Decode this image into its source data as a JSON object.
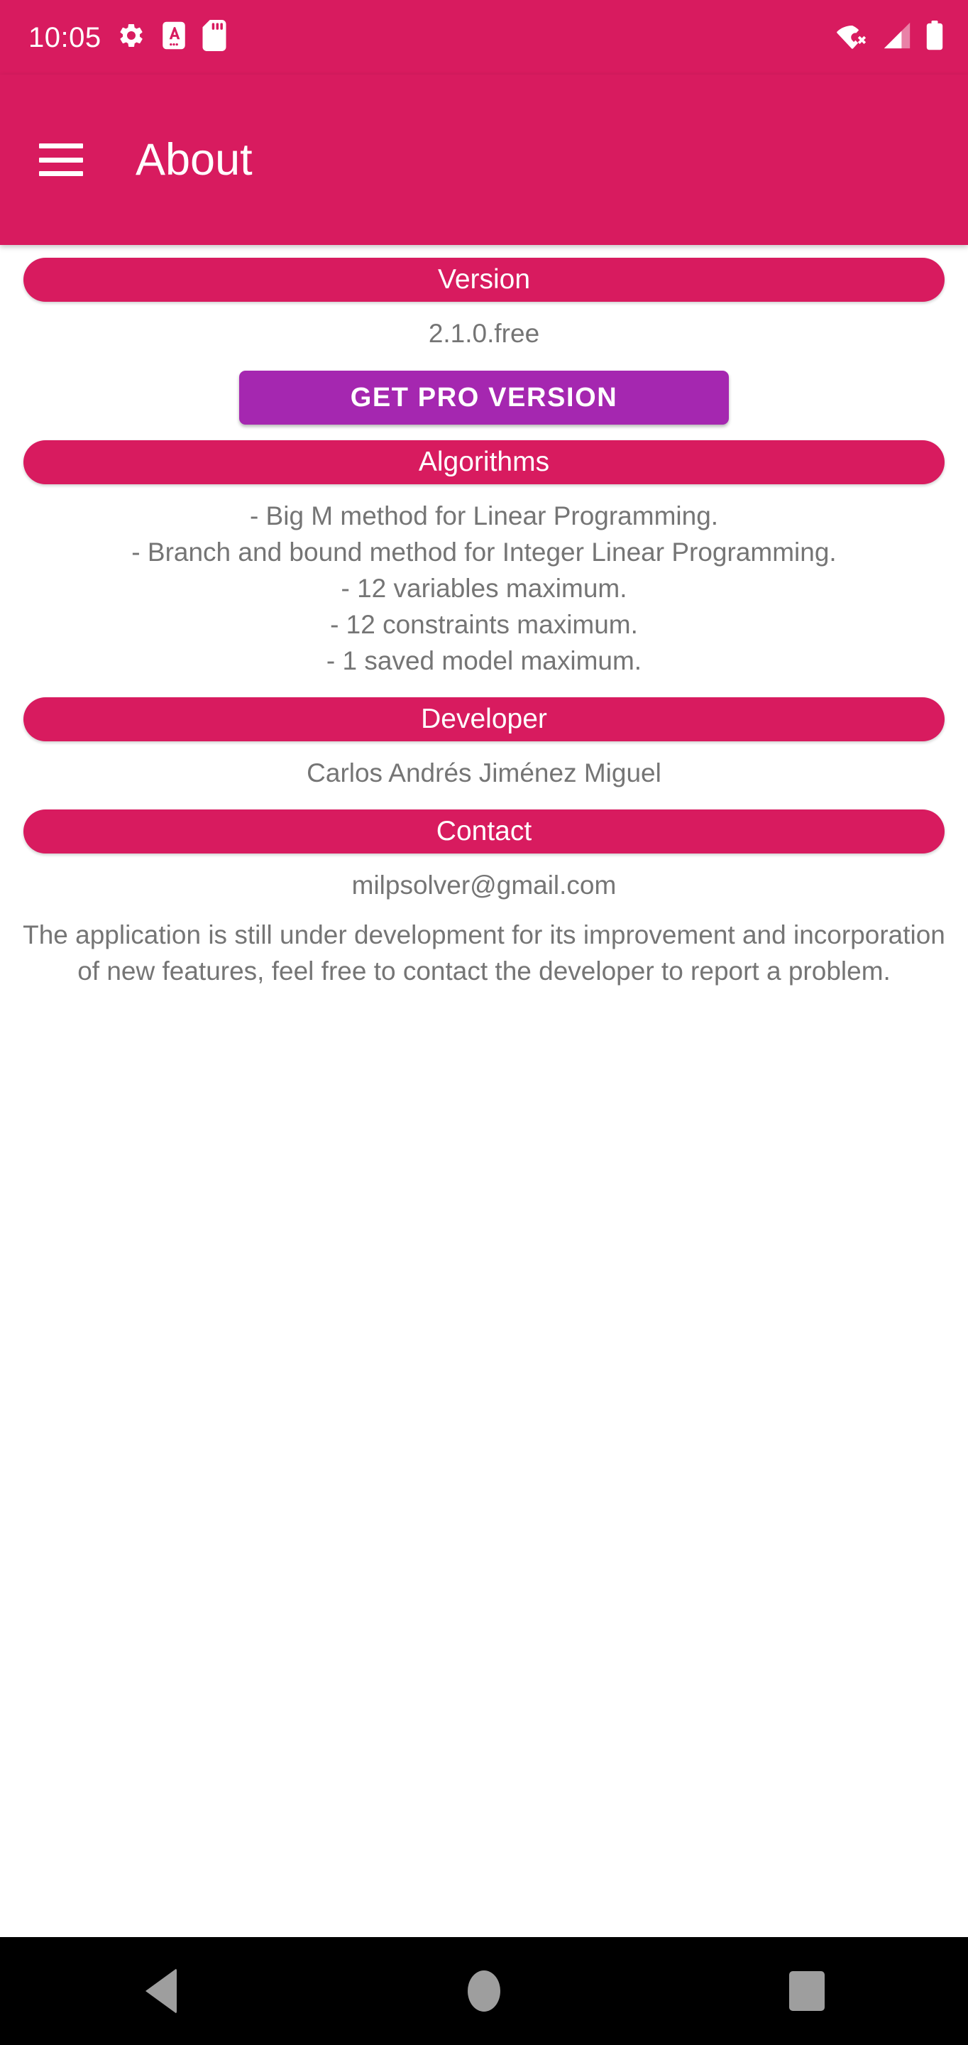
{
  "status_bar": {
    "time": "10:05",
    "left_icons": [
      "gear-icon",
      "keyboard-language-icon",
      "sd-card-icon"
    ],
    "right_icons": [
      "wifi-off-icon",
      "cellular-signal-icon",
      "battery-full-icon"
    ],
    "background_color": "#D81B5F",
    "foreground_color": "#FFFFFF"
  },
  "app_bar": {
    "menu_icon": "hamburger-menu-icon",
    "title": "About",
    "background_color": "#D81B5F"
  },
  "sections": {
    "version": {
      "heading": "Version",
      "value": "2.1.0.free"
    },
    "pro": {
      "button_label": "GET PRO VERSION",
      "button_color": "#A527B0"
    },
    "algorithms": {
      "heading": "Algorithms",
      "items": [
        "- Big M method for Linear Programming.",
        "- Branch and bound method for Integer Linear Programming.",
        "- 12 variables maximum.",
        "- 12 constraints maximum.",
        "- 1 saved model maximum."
      ]
    },
    "developer": {
      "heading": "Developer",
      "name": "Carlos Andrés Jiménez Miguel"
    },
    "contact": {
      "heading": "Contact",
      "email": "milpsolver@gmail.com",
      "note": "The application is still under development for its improvement and incorporation of new features, feel free to contact the developer to report a problem."
    }
  },
  "nav_bar": {
    "back_label": "Back",
    "home_label": "Home",
    "recents_label": "Recents",
    "background_color": "#000000"
  },
  "theme": {
    "accent": "#D81B5F",
    "pro_purple": "#A527B0",
    "body_text": "#757575",
    "page_background": "#FFFFFF"
  }
}
